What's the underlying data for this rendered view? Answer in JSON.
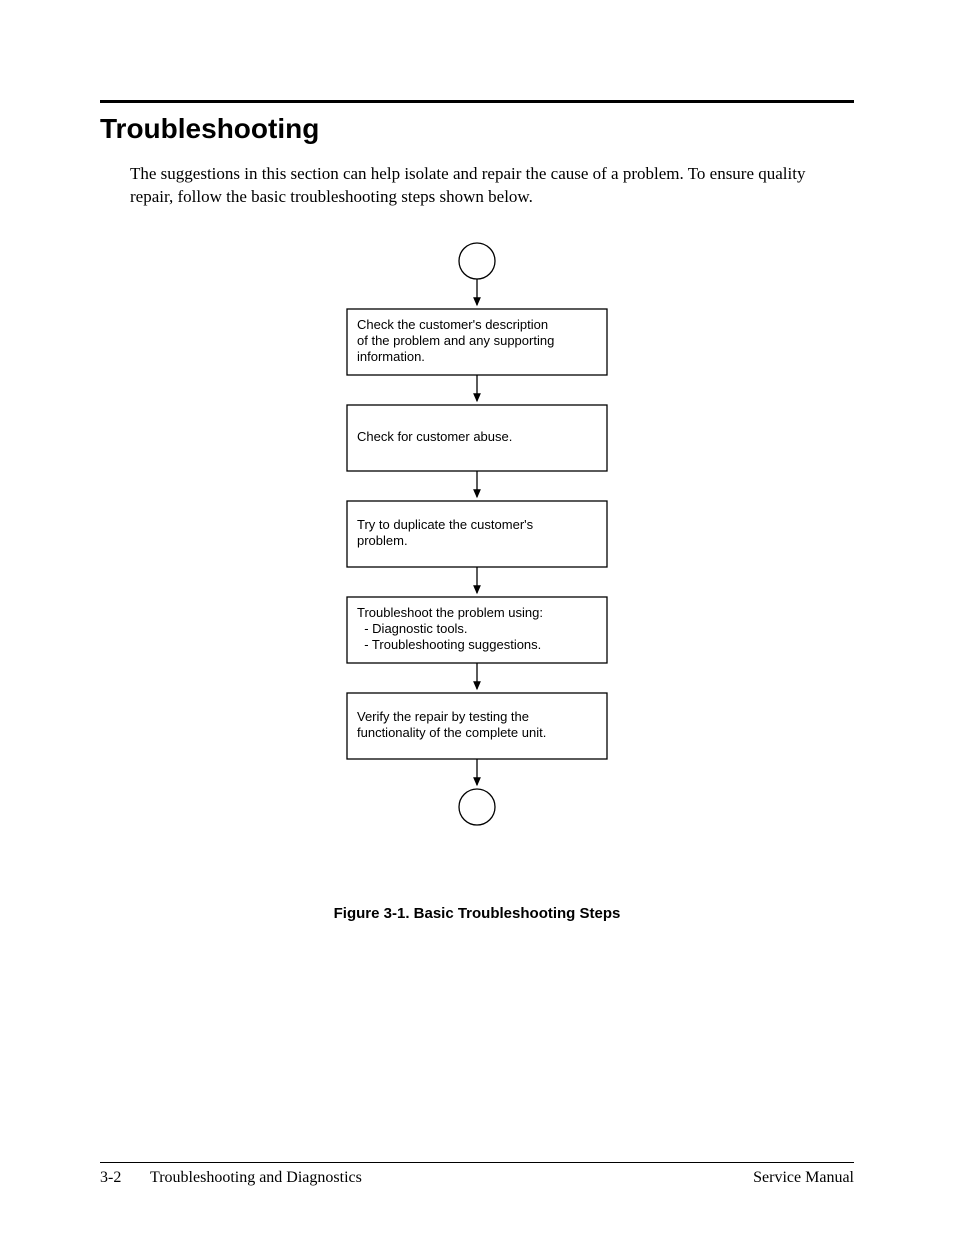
{
  "heading": "Troubleshooting",
  "intro": "The suggestions in this section can help isolate and repair the cause of a problem. To ensure quality repair, follow the basic troubleshooting steps shown below.",
  "flow": {
    "step1": {
      "l1": "Check the customer's description",
      "l2": "of the problem and any supporting",
      "l3": "information."
    },
    "step2": {
      "l1": "Check for customer abuse."
    },
    "step3": {
      "l1": "Try to duplicate the customer's",
      "l2": "problem."
    },
    "step4": {
      "l1": "Troubleshoot the problem using:",
      "l2": "  - Diagnostic tools.",
      "l3": "  - Troubleshooting suggestions."
    },
    "step5": {
      "l1": "Verify the repair by testing the",
      "l2": "functionality of the complete unit."
    }
  },
  "caption": "Figure 3-1. Basic Troubleshooting Steps",
  "chart_data": {
    "type": "flowchart",
    "title": "Figure 3-1. Basic Troubleshooting Steps",
    "nodes": [
      {
        "id": "start",
        "shape": "circle",
        "label": ""
      },
      {
        "id": "s1",
        "shape": "rect",
        "label": "Check the customer's description of the problem and any supporting information."
      },
      {
        "id": "s2",
        "shape": "rect",
        "label": "Check for customer abuse."
      },
      {
        "id": "s3",
        "shape": "rect",
        "label": "Try to duplicate the customer's problem."
      },
      {
        "id": "s4",
        "shape": "rect",
        "label": "Troubleshoot the problem using:\n - Diagnostic tools.\n - Troubleshooting suggestions."
      },
      {
        "id": "s5",
        "shape": "rect",
        "label": "Verify the repair by testing the functionality of the complete unit."
      },
      {
        "id": "end",
        "shape": "circle",
        "label": ""
      }
    ],
    "edges": [
      {
        "from": "start",
        "to": "s1"
      },
      {
        "from": "s1",
        "to": "s2"
      },
      {
        "from": "s2",
        "to": "s3"
      },
      {
        "from": "s3",
        "to": "s4"
      },
      {
        "from": "s4",
        "to": "s5"
      },
      {
        "from": "s5",
        "to": "end"
      }
    ]
  },
  "footer": {
    "page": "3-2",
    "chapter": "Troubleshooting and Diagnostics",
    "manual": "Service Manual"
  }
}
